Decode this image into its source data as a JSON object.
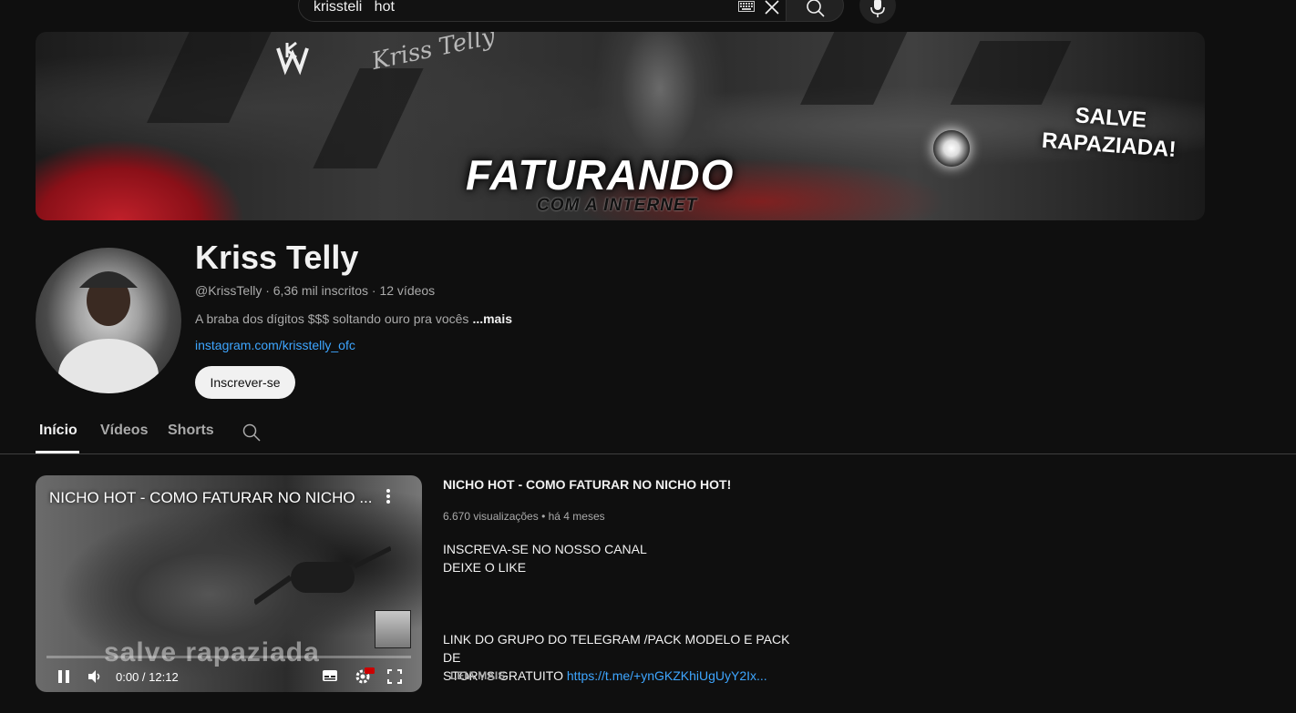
{
  "search": {
    "query": "krissteli   hot"
  },
  "banner": {
    "signature": "Kriss Telly",
    "headline": "FATURANDO",
    "subline": "COM A INTERNET",
    "salve_line1": "SALVE",
    "salve_line2": "RAPAZIADA!"
  },
  "channel": {
    "name": "Kriss Telly",
    "meta": "@KrissTelly · 6,36 mil inscritos · 12 vídeos",
    "description": "A braba dos dígitos $$$ soltando ouro pra vocês",
    "more_label": "...mais",
    "link": "instagram.com/krisstelly_ofc",
    "subscribe_label": "Inscrever-se"
  },
  "tabs": [
    {
      "label": "Início",
      "active": true
    },
    {
      "label": "Vídeos",
      "active": false
    },
    {
      "label": "Shorts",
      "active": false
    }
  ],
  "featured": {
    "player_title": "NICHO HOT - COMO FATURAR NO NICHO ...",
    "watermark": "salve rapaziada",
    "time": "0:00 / 12:12",
    "progress": 0,
    "title": "NICHO HOT - COMO FATURAR NO NICHO HOT!",
    "stats": "6.670 visualizações • há 4 meses",
    "desc_line1": "INSCREVA-SE NO NOSSO CANAL",
    "desc_line2": "DEIXE O LIKE",
    "desc_line3": "LINK DO GRUPO DO TELEGRAM /PACK MODELO E PACK DE",
    "desc_line4_prefix": "STORYS GRATUITO ",
    "desc_link": "https://t.me/+ynGKZKhiUgUyY2Ix...",
    "read_more": "LEIA MAIS"
  },
  "colors": {
    "background": "#0f0f0f",
    "link": "#3ea6ff",
    "text": "#f1f1f1",
    "muted": "#aaaaaa"
  }
}
